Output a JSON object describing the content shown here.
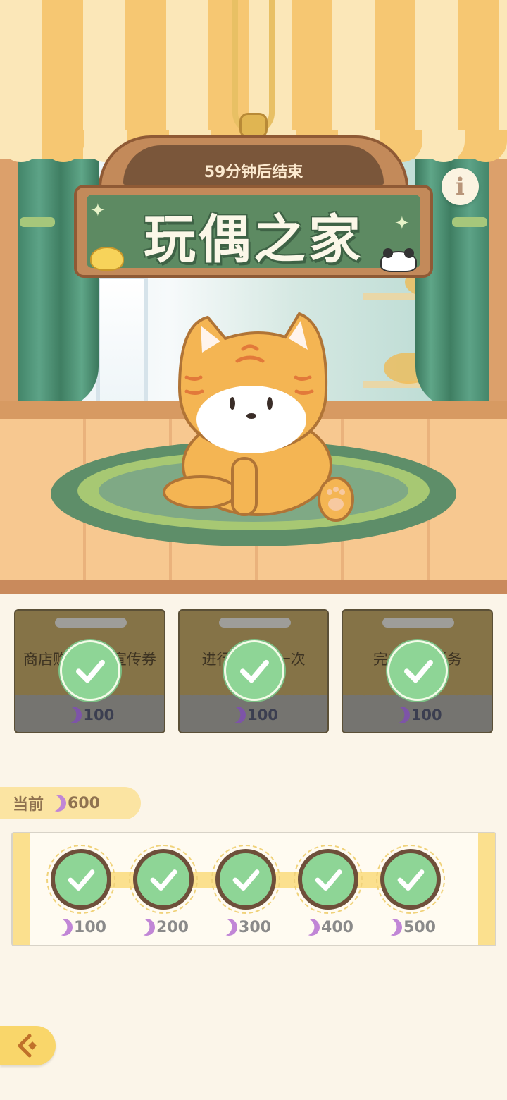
{
  "event": {
    "timer_text": "59分钟后结束",
    "title": "玩偶之家"
  },
  "tasks": [
    {
      "description": "商店购买高级宣传券",
      "reward": "100",
      "completed": true
    },
    {
      "description": "进行前台取一次",
      "reward": "100",
      "completed": true
    },
    {
      "description": "完成前台任务",
      "reward": "100",
      "completed": true
    }
  ],
  "progress": {
    "label": "当前",
    "current": "600",
    "milestones": [
      {
        "value": "100",
        "completed": true
      },
      {
        "value": "200",
        "completed": true
      },
      {
        "value": "300",
        "completed": true
      },
      {
        "value": "400",
        "completed": true
      },
      {
        "value": "500",
        "completed": true
      }
    ]
  },
  "icons": {
    "info": "info-icon",
    "currency": "moon-icon",
    "check": "check-icon",
    "back": "back-arrow-icon"
  },
  "colors": {
    "accent_yellow": "#f9d66a",
    "check_green": "#8ed596",
    "sign_green": "#5d8a62",
    "currency_purple": "#7d54a8"
  }
}
